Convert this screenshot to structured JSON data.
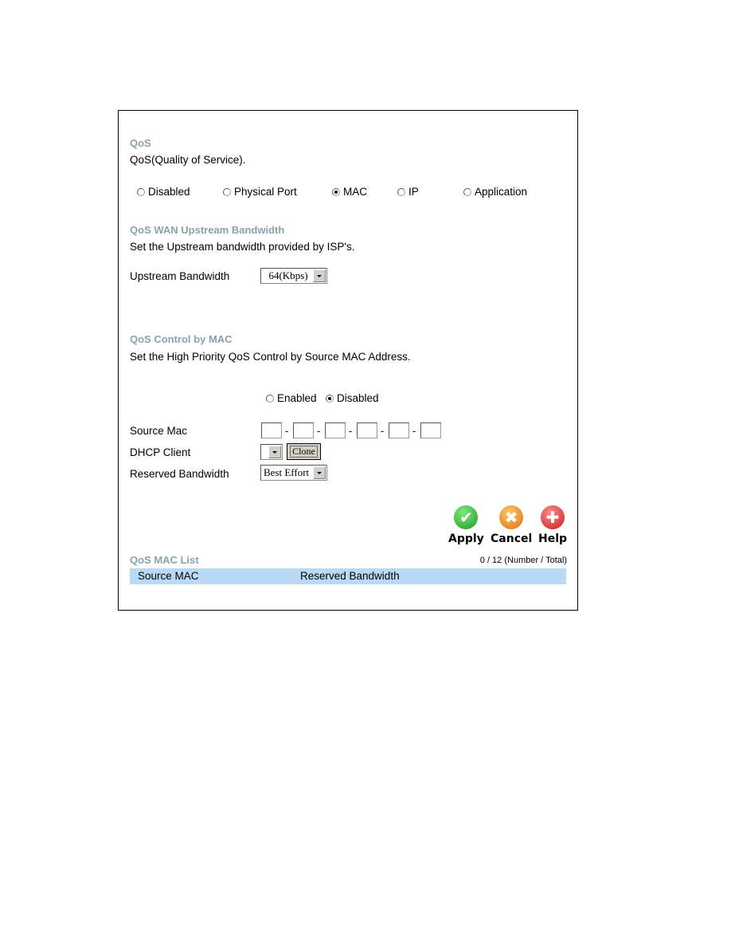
{
  "qos": {
    "heading": "QoS",
    "description": "QoS(Quality of Service).",
    "modes": [
      {
        "label": "Disabled",
        "checked": false
      },
      {
        "label": "Physical Port",
        "checked": false
      },
      {
        "label": "MAC",
        "checked": true
      },
      {
        "label": "IP",
        "checked": false
      },
      {
        "label": "Application",
        "checked": false
      }
    ]
  },
  "upstream": {
    "heading": "QoS WAN Upstream Bandwidth",
    "description": "Set the Upstream bandwidth provided by ISP's.",
    "field_label": "Upstream Bandwidth",
    "selected": "64(Kbps)"
  },
  "mac_control": {
    "heading": "QoS Control by MAC",
    "description": "Set the High Priority QoS Control by Source MAC Address.",
    "state_options": [
      {
        "label": "Enabled",
        "checked": false
      },
      {
        "label": "Disabled",
        "checked": true
      }
    ],
    "source_mac_label": "Source Mac",
    "source_mac_values": [
      "",
      "",
      "",
      "",
      "",
      ""
    ],
    "mac_separator": "-",
    "dhcp_client_label": "DHCP Client",
    "dhcp_client_selected": "",
    "clone_label": "Clone",
    "reserved_bw_label": "Reserved Bandwidth",
    "reserved_bw_selected": "Best Effort"
  },
  "actions": {
    "apply": "Apply",
    "cancel": "Cancel",
    "help": "Help"
  },
  "mac_list": {
    "heading": "QoS MAC List",
    "count": "0 / 12 (Number / Total)",
    "columns": [
      "Source MAC",
      "Reserved Bandwidth"
    ],
    "rows": []
  },
  "colors": {
    "heading": "#8aa3aa",
    "table_header_bg": "#b9d9f5"
  }
}
